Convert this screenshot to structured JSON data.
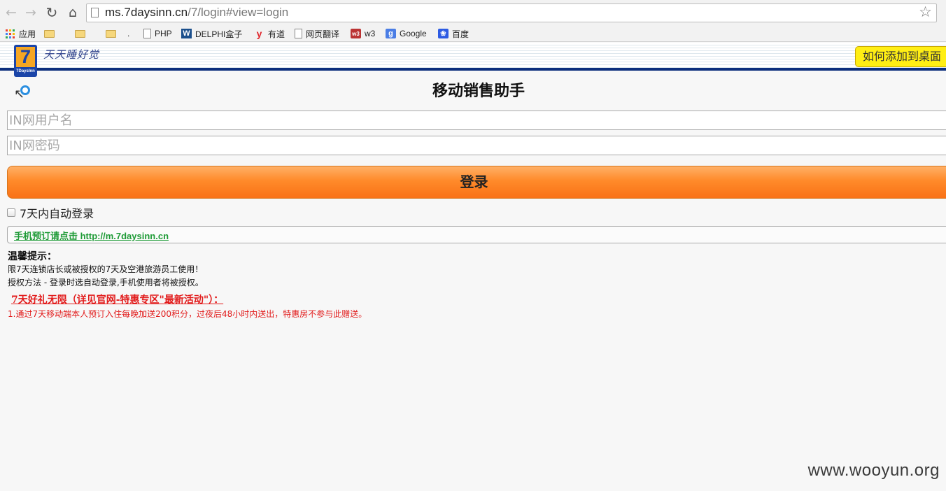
{
  "browser": {
    "url_host": "ms.7daysinn.cn",
    "url_path": "/7/login#view=login",
    "bookmarks": [
      {
        "label": "应用",
        "icon": "apps-grid-icon"
      },
      {
        "label": "",
        "icon": "folder-icon"
      },
      {
        "label": "",
        "icon": "folder-icon"
      },
      {
        "label": ".",
        "icon": "folder-icon"
      },
      {
        "label": "PHP",
        "icon": "page-icon"
      },
      {
        "label": "DELPHI盒子",
        "icon": "delphi-w-icon"
      },
      {
        "label": "有道",
        "icon": "youdao-icon"
      },
      {
        "label": "网页翻译",
        "icon": "page-icon"
      },
      {
        "label": "w3",
        "icon": "w3-icon"
      },
      {
        "label": "Google",
        "icon": "google-icon"
      },
      {
        "label": "百度",
        "icon": "baidu-paw-icon"
      }
    ]
  },
  "header": {
    "logo_number": "7",
    "logo_text": "7DaysInn",
    "slogan": "天天睡好觉",
    "add_to_desktop": "如何添加到桌面"
  },
  "login": {
    "title": "移动销售助手",
    "username_placeholder": "IN网用户名",
    "password_placeholder": "IN网密码",
    "submit_label": "登录",
    "remember_label": "7天内自动登录",
    "mobile_link": "手机预订请点击 http://m.7daysinn.cn"
  },
  "tips": {
    "title": "温馨提示：",
    "lines": [
      "限7天连锁店长或被授权的7天及空港旅游员工使用！",
      "授权方法 - 登录时选自动登录,手机使用者将被授权。"
    ],
    "promo_title": "7天好礼无限（详见官网-特惠专区\"最新活动\"）：",
    "promo_items": [
      "1.通过7天移动端本人预订入住每晚加送200积分，过夜后48小时内送出，特惠房不参与此赠送。"
    ]
  },
  "watermark": "www.wooyun.org",
  "colors": {
    "header_bar": "#0c2f7d",
    "login_button": "#ff8a2a",
    "add_desktop_button": "#ffee14",
    "link_green": "#1f9b37",
    "promo_red": "#e21c1c"
  }
}
